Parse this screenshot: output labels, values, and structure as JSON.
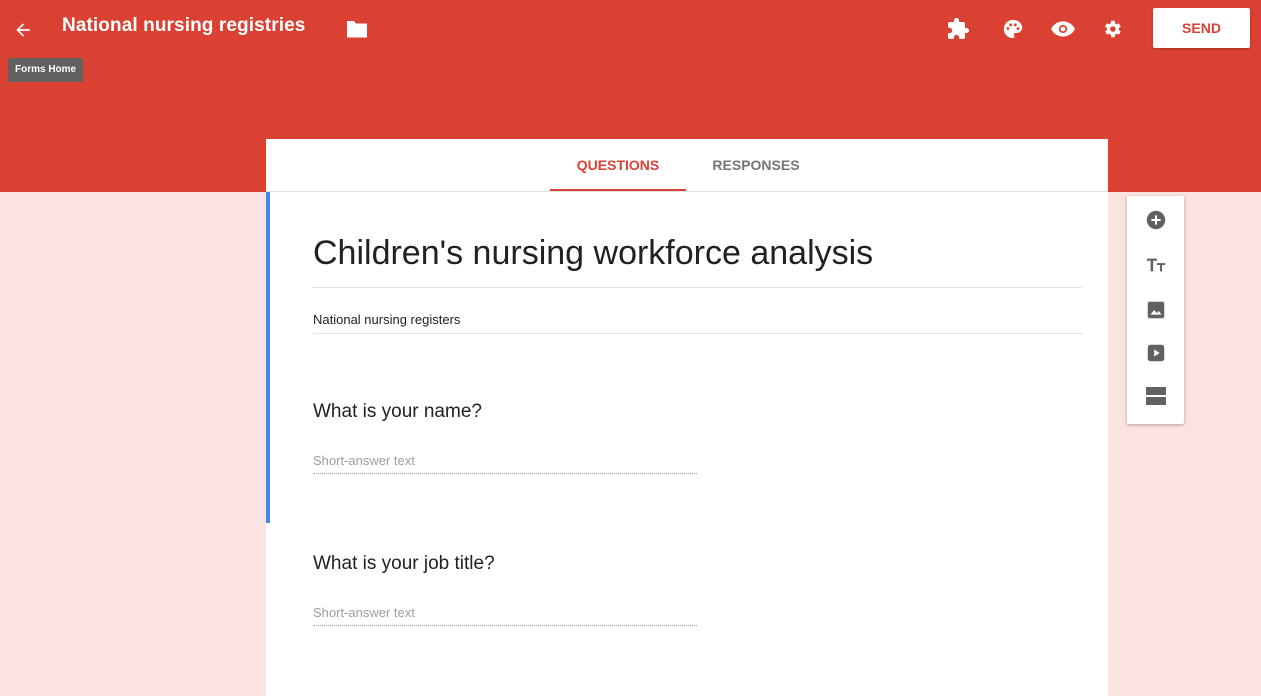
{
  "header": {
    "title": "National nursing registries",
    "tooltip": "Forms Home",
    "send_label": "SEND",
    "icons": [
      "arrow-back-icon",
      "folder-icon",
      "addon-puzzle-icon",
      "palette-icon",
      "eye-preview-icon",
      "gear-settings-icon"
    ]
  },
  "tabs": [
    {
      "label": "QUESTIONS",
      "active": true
    },
    {
      "label": "RESPONSES",
      "active": false
    }
  ],
  "form": {
    "title": "Children's nursing workforce analysis",
    "description": "National nursing registers",
    "questions": [
      {
        "title": "What is your name?",
        "placeholder": "Short-answer text"
      },
      {
        "title": "What is your job title?",
        "placeholder": "Short-answer text"
      }
    ]
  },
  "toolbox": [
    "add-question-icon",
    "add-title-icon",
    "add-image-icon",
    "add-video-icon",
    "add-section-icon"
  ],
  "colors": {
    "primary": "#db4132",
    "background": "#fae3e1",
    "active_accent": "#4285f4",
    "icon_gray": "#616161"
  }
}
